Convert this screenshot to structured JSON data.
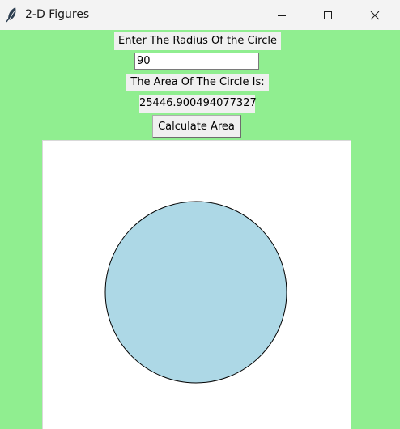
{
  "window": {
    "title": "2-D Figures",
    "app_icon": "feather-icon"
  },
  "colors": {
    "window_background": "#90ee90",
    "canvas_background": "#ffffff",
    "circle_fill": "#add8e6",
    "circle_outline": "#000000"
  },
  "form": {
    "radius_label": "Enter The Radius Of the Circle",
    "radius_value": "90",
    "area_label": "The Area Of The Circle Is:",
    "area_value": "25446.900494077327",
    "calculate_button_label": "Calculate Area"
  },
  "canvas": {
    "shape": "circle"
  }
}
